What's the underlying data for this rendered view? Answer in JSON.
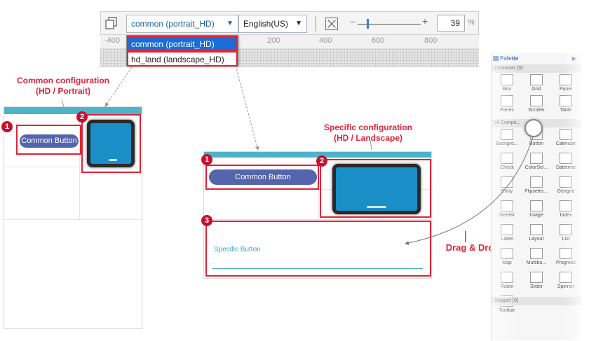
{
  "toolbar": {
    "profile_selected": "common (portrait_HD)",
    "language_selected": "English(US)",
    "zoom_value": "39",
    "zoom_unit": "%",
    "zoom_minus": "−",
    "zoom_plus": "+",
    "zoom_slider_level": 0.15
  },
  "ruler": {
    "ticks": [
      "-400",
      "200",
      "400",
      "600",
      "800"
    ]
  },
  "profile_options": [
    "common (portrait_HD)",
    "hd_land (landscape_HD)"
  ],
  "captions": {
    "common_line1": "Common configuration",
    "common_line2": "(HD / Portrait)",
    "specific_line1": "Specific configuration",
    "specific_line2": "(HD / Landscape)",
    "drag_drop": "Drag & Drop"
  },
  "portrait": {
    "button_label": "Common Button",
    "badge_1": "1",
    "badge_2": "2"
  },
  "landscape": {
    "button_label": "Common Button",
    "specific_button_label": "Specific Button",
    "badge_1": "1",
    "badge_2": "2",
    "badge_3": "3"
  },
  "palette": {
    "title": "Palette",
    "section_container": "Container (0)",
    "section_components": "UI Compo...",
    "section_snippet": "Snippet (0)",
    "container_items": [
      "Box",
      "Grid",
      "Panel",
      "Panes",
      "Scroller",
      "Table"
    ],
    "component_items": [
      "Backgro...",
      "Button",
      "Calendar",
      "Check",
      "ColorSel...",
      "Datetime",
      "Entry",
      "Flipselec...",
      "Gengrid",
      "Genlist",
      "Image",
      "Index",
      "Label",
      "Layout",
      "List",
      "Map",
      "Multibu...",
      "Progress",
      "Radio",
      "Slider",
      "Spinner",
      "Toolbar"
    ]
  },
  "colors": {
    "accent_red": "#e0233a",
    "device_header": "#4cb3c9",
    "button_fill": "#5565ad",
    "selected_option": "#1a6dd6"
  }
}
